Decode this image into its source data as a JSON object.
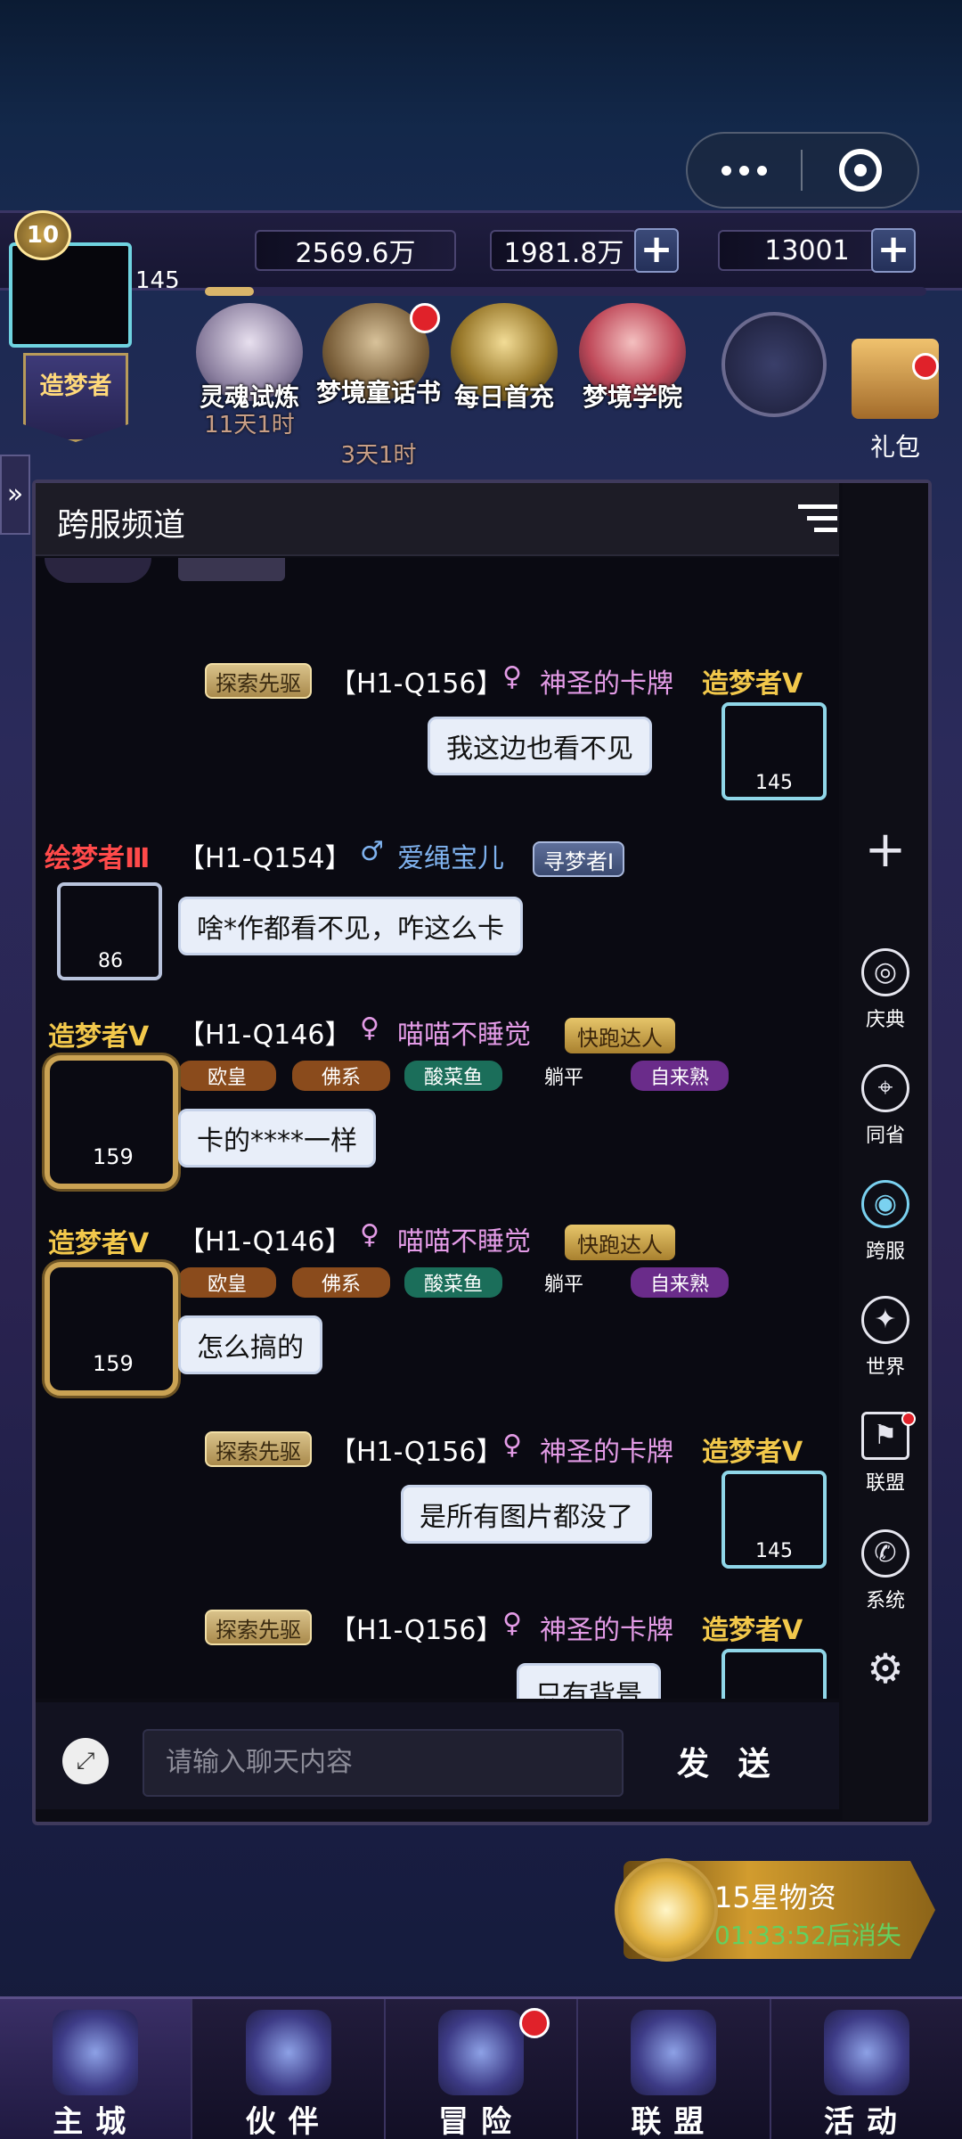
{
  "header": {
    "level": "10",
    "avatar_value": "145",
    "dreamer_title": "造梦者"
  },
  "resources": {
    "r1": "2569.6万",
    "r2": "1981.8万",
    "r3": "13001"
  },
  "activities": [
    {
      "label": "灵魂试炼",
      "time": "11天1时"
    },
    {
      "label": "梦境童话书",
      "time": "3天1时"
    },
    {
      "label": "每日首充",
      "time": ""
    },
    {
      "label": "梦境学院",
      "time": ""
    }
  ],
  "gift_label": "礼包",
  "chat": {
    "title": "跨服频道",
    "input_placeholder": "请输入聊天内容",
    "send_label": "发 送",
    "messages": [
      {
        "tag": "探索先驱",
        "server": "【H1-Q156】",
        "gender": "♀",
        "name": "神圣的卡牌",
        "rank": "造梦者Ⅴ",
        "text": "我这边也看不见",
        "frame_value": "145"
      },
      {
        "rank": "绘梦者Ⅲ",
        "server": "【H1-Q154】",
        "gender": "♂",
        "name": "爱绳宝儿",
        "badge": "寻梦者Ⅰ",
        "text": "啥*作都看不见，咋这么卡",
        "frame_value": "86"
      },
      {
        "rank": "造梦者Ⅴ",
        "server": "【H1-Q146】",
        "gender": "♀",
        "name": "喵喵不睡觉",
        "hobby": "快跑达人",
        "chips": [
          "欧皇",
          "佛系",
          "酸菜鱼",
          "躺平",
          "自来熟"
        ],
        "text": "卡的****一样",
        "frame_value": "159"
      },
      {
        "rank": "造梦者Ⅴ",
        "server": "【H1-Q146】",
        "gender": "♀",
        "name": "喵喵不睡觉",
        "hobby": "快跑达人",
        "chips": [
          "欧皇",
          "佛系",
          "酸菜鱼",
          "躺平",
          "自来熟"
        ],
        "text": "怎么搞的",
        "frame_value": "159"
      },
      {
        "tag": "探索先驱",
        "server": "【H1-Q156】",
        "gender": "♀",
        "name": "神圣的卡牌",
        "rank": "造梦者Ⅴ",
        "text": "是所有图片都没了",
        "frame_value": "145"
      },
      {
        "tag": "探索先驱",
        "server": "【H1-Q156】",
        "gender": "♀",
        "name": "神圣的卡牌",
        "rank": "造梦者Ⅴ",
        "text": "只有背景"
      }
    ]
  },
  "side_menu": [
    {
      "label": "",
      "icon": "plus-icon"
    },
    {
      "label": "庆典",
      "icon": "celebration-icon"
    },
    {
      "label": "同省",
      "icon": "location-icon"
    },
    {
      "label": "跨服",
      "icon": "globe-icon",
      "active": true
    },
    {
      "label": "世界",
      "icon": "compass-icon"
    },
    {
      "label": "联盟",
      "icon": "alliance-icon"
    },
    {
      "label": "系统",
      "icon": "megaphone-icon"
    },
    {
      "label": "",
      "icon": "gear-icon"
    }
  ],
  "event": {
    "title": "15星物资",
    "timer": "01:33:52后消失"
  },
  "nav": [
    {
      "label": "主城",
      "active": true
    },
    {
      "label": "伙伴"
    },
    {
      "label": "冒险"
    },
    {
      "label": "联盟"
    },
    {
      "label": "活动"
    }
  ],
  "colors": {
    "accent_gold": "#f2c84b",
    "female_name": "#e39be6",
    "male_name": "#7fb2ee",
    "red_rank": "#ff4a4a",
    "timer_green": "#64d060"
  }
}
